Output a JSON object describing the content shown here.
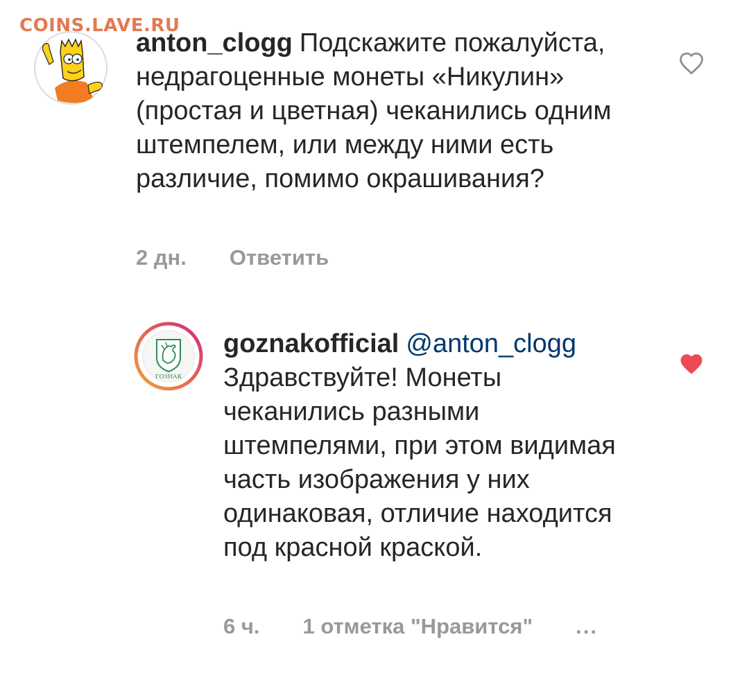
{
  "watermark": "COINS.LAVE.RU",
  "comments": [
    {
      "username": "anton_clogg",
      "text": "Подскажите пожалуйста, недрагоценные монеты «Никулин» (простая и цветная) чеканились одним штемпелем, или между ними есть различие, помимо окрашивания?",
      "time": "2 дн.",
      "reply_label": "Ответить",
      "avatar_icon": "bart-simpson-avatar",
      "like_icon": "heart-outline-icon",
      "liked": false
    },
    {
      "username": "goznakofficial",
      "mention": "@anton_clogg",
      "text": "Здравствуйте! Монеты чеканились разными штемпелями, при этом видимая часть изображения у них одинаковая, отличие находится под красной краской.",
      "time": "6 ч.",
      "likes_label": "1 отметка \"Нравится\"",
      "more_label": "...",
      "avatar_logo_text": "ГОЗНАК",
      "avatar_icon": "goznak-logo-avatar",
      "like_icon": "heart-filled-icon",
      "liked": true
    }
  ],
  "colors": {
    "heart_liked": "#ed4956",
    "heart_outline": "#8e8e8e",
    "mention": "#00376b",
    "meta_text": "#999999",
    "watermark": "#e27a52",
    "story_ring_start": "#f0a33a",
    "story_ring_end": "#d62976"
  }
}
